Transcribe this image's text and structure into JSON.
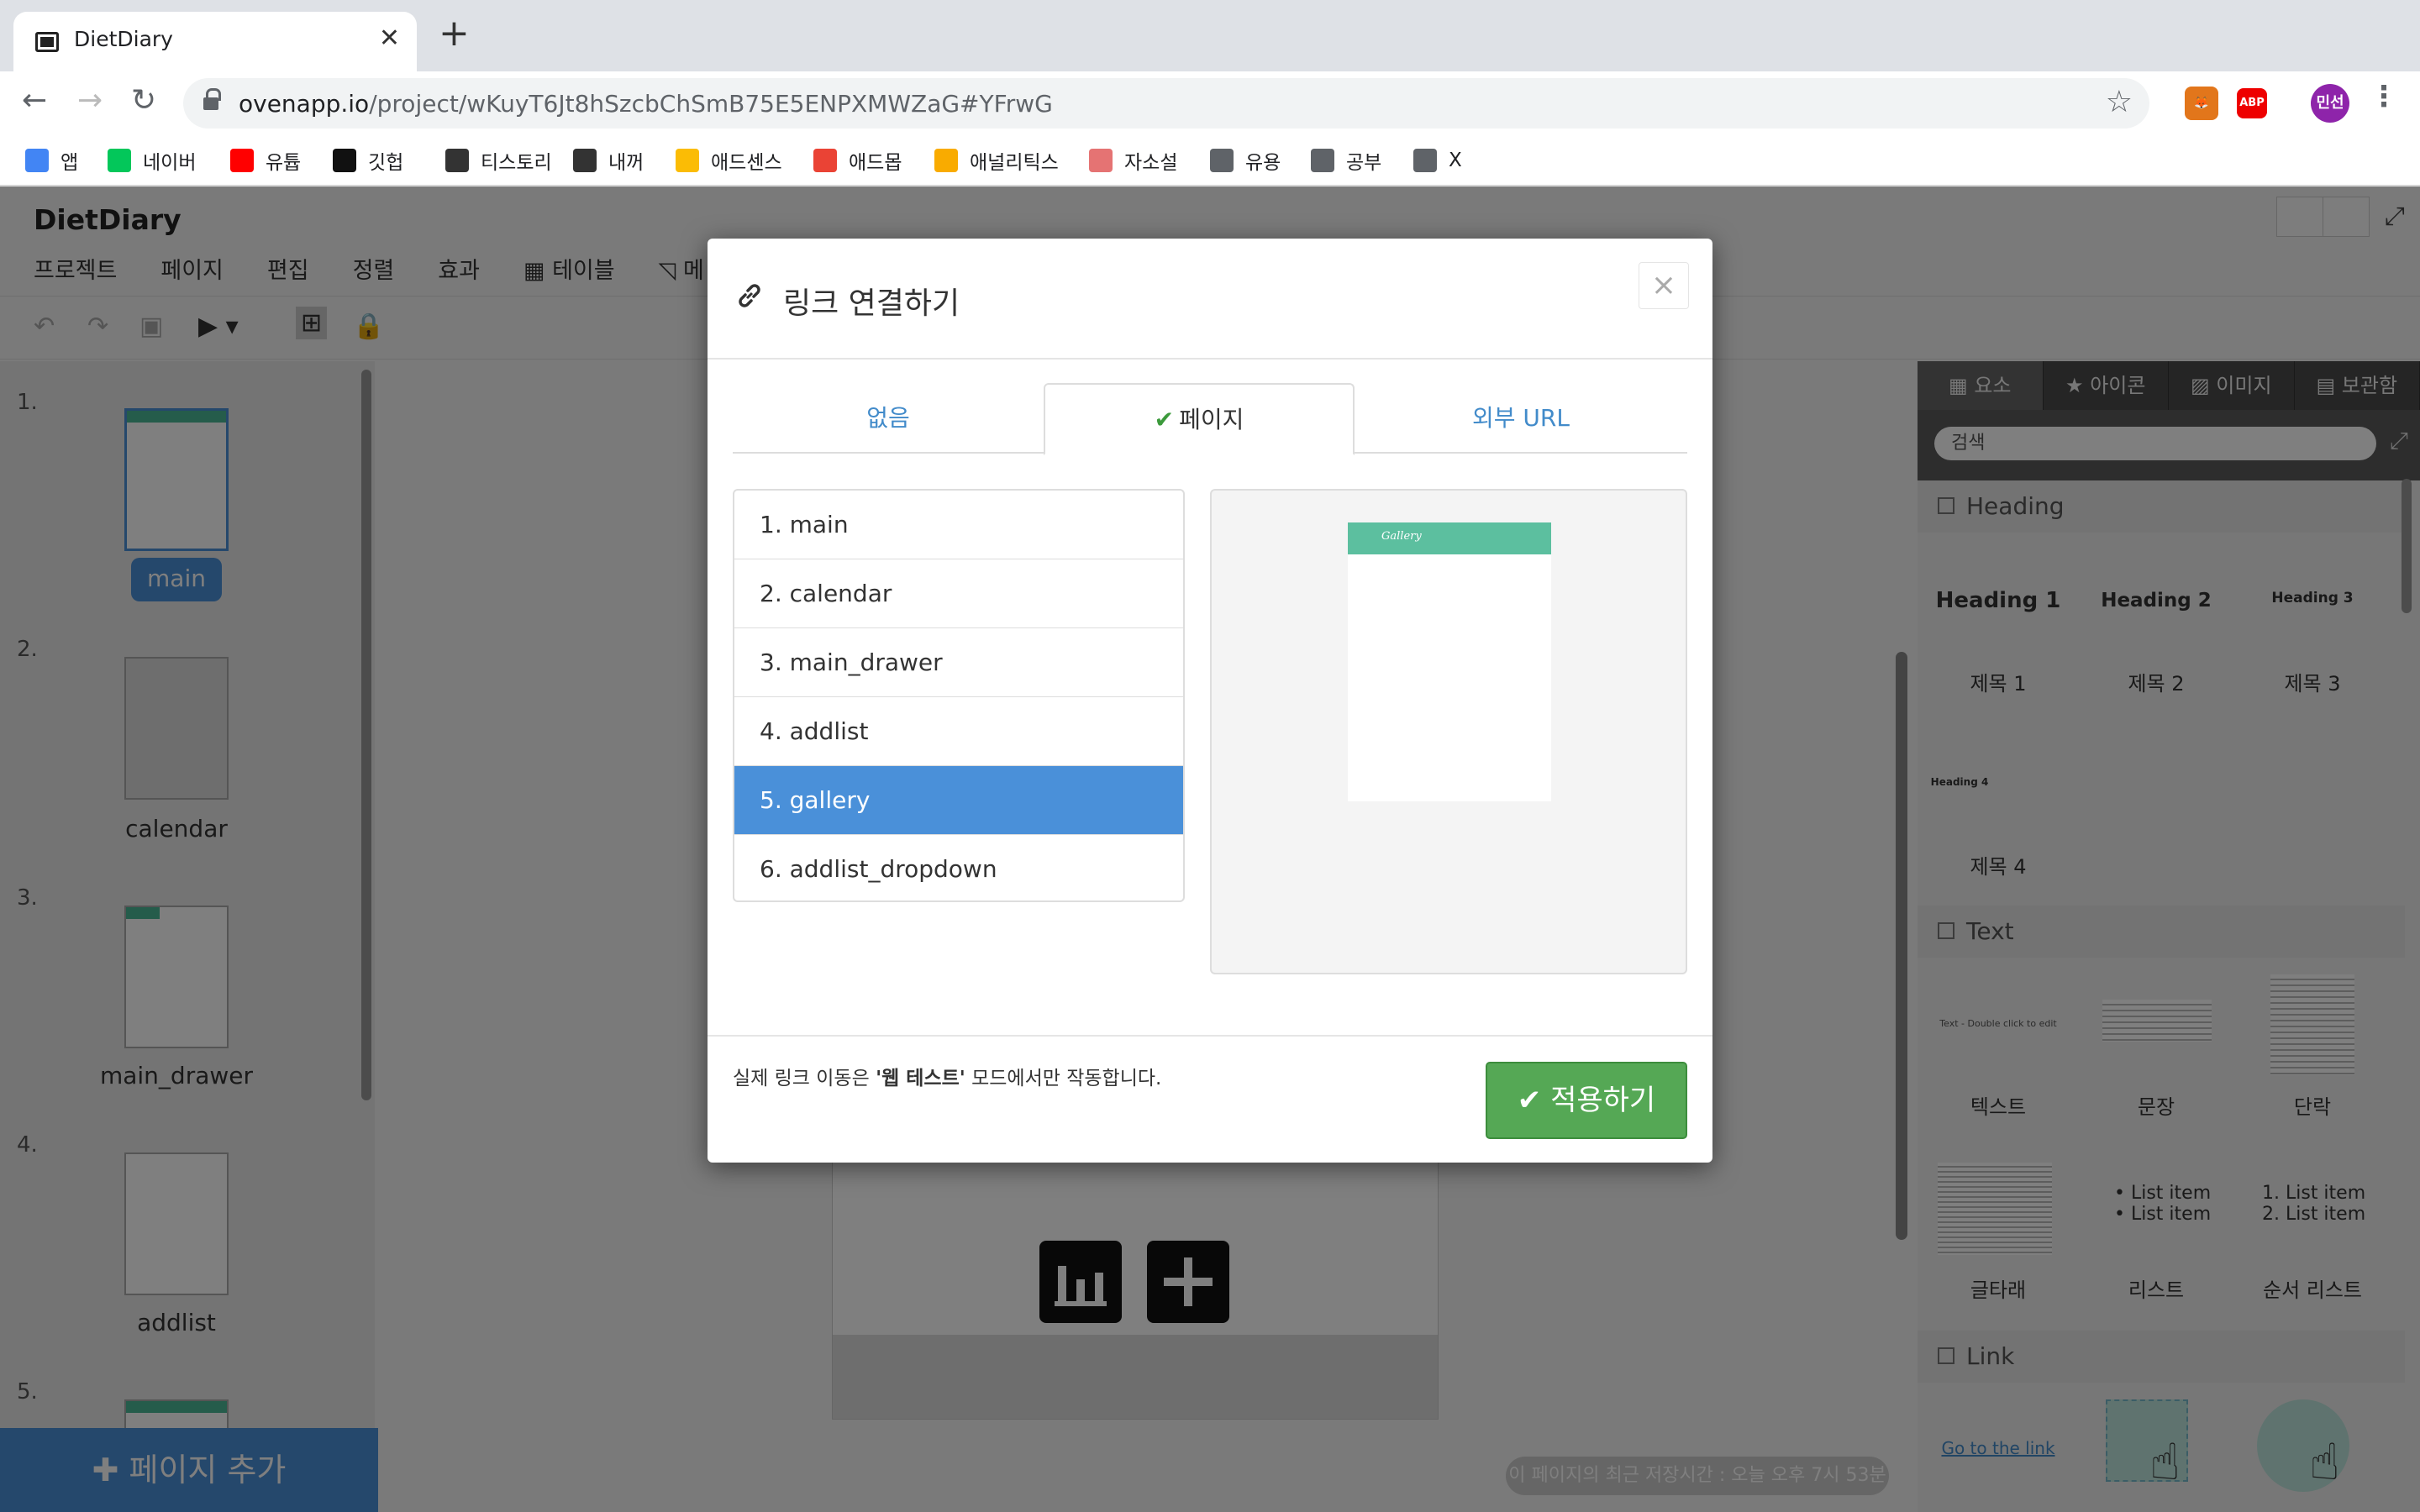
{
  "browser": {
    "tab_title": "DietDiary",
    "tab_close": "✕",
    "new_tab": "+",
    "url_host": "ovenapp.io",
    "url_path": "/project/wKuyT6Jt8hSzcbChSmB75E5ENPXMWZaG#YFrwG",
    "profile_label": "민선",
    "abp_label": "ABP",
    "bookmarks": [
      {
        "label": "앱",
        "color": "#4285f4"
      },
      {
        "label": "네이버",
        "color": "#03c75a"
      },
      {
        "label": "유튭",
        "color": "#ff0000"
      },
      {
        "label": "깃헙",
        "color": "#111111"
      },
      {
        "label": "티스토리",
        "color": "#333333"
      },
      {
        "label": "내꺼",
        "color": "#333333"
      },
      {
        "label": "애드센스",
        "color": "#fbbc05"
      },
      {
        "label": "애드몹",
        "color": "#ea4335"
      },
      {
        "label": "애널리틱스",
        "color": "#f9ab00"
      },
      {
        "label": "자소설",
        "color": "#e57373"
      },
      {
        "label": "유용",
        "color": "#5f6368"
      },
      {
        "label": "공부",
        "color": "#5f6368"
      },
      {
        "label": "X",
        "color": "#5f6368"
      }
    ]
  },
  "app": {
    "title": "DietDiary",
    "menu": [
      "프로젝트",
      "페이지",
      "편집",
      "정렬",
      "효과",
      "테이블",
      "메"
    ],
    "pages": [
      {
        "num": "1.",
        "label": "main"
      },
      {
        "num": "2.",
        "label": "calendar"
      },
      {
        "num": "3.",
        "label": "main_drawer"
      },
      {
        "num": "4.",
        "label": "addlist"
      },
      {
        "num": "5.",
        "label": ""
      }
    ],
    "add_page": "페이지 추가",
    "save_status": "이 페이지의 최근 저장시간 : 오늘 오후 7시 53분"
  },
  "right_panel": {
    "tabs": [
      "요소",
      "아이콘",
      "이미지",
      "보관함"
    ],
    "search_placeholder": "검색",
    "sections": {
      "heading": "Heading",
      "text": "Text",
      "link": "Link"
    },
    "heading_items": [
      {
        "preview": "Heading 1",
        "label": "제목 1"
      },
      {
        "preview": "Heading 2",
        "label": "제목 2"
      },
      {
        "preview": "Heading 3",
        "label": "제목 3"
      },
      {
        "preview": "Heading 4",
        "label": "제목 4"
      }
    ],
    "text_items": [
      {
        "preview": "Text - Double click to edit",
        "label": "텍스트"
      },
      {
        "preview": "",
        "label": "문장"
      },
      {
        "preview": "",
        "label": "단락"
      },
      {
        "preview": "",
        "label": "글타래"
      },
      {
        "preview": "• List item",
        "label": "리스트"
      },
      {
        "preview": "1. List item",
        "label": "순서 리스트"
      }
    ],
    "list_preview": [
      "• List item",
      "• List item"
    ],
    "olist_preview": [
      "1. List item",
      "2. List item"
    ],
    "link_items": [
      {
        "preview": "Go to the link"
      }
    ]
  },
  "modal": {
    "title": "링크 연결하기",
    "close": "×",
    "tabs": {
      "none": "없음",
      "page": "페이지",
      "external": "외부 URL"
    },
    "page_list": [
      "1. main",
      "2. calendar",
      "3. main_drawer",
      "4. addlist",
      "5. gallery",
      "6. addlist_dropdown"
    ],
    "selected_index": 4,
    "preview_header": "Gallery",
    "footnote_prefix": "실제 링크 이동은 ",
    "footnote_bold": "'웹 테스트'",
    "footnote_suffix": " 모드에서만 작동합니다.",
    "apply": "적용하기"
  },
  "colors": {
    "accent": "#4a90d9",
    "apply_green": "#55a855",
    "header_teal": "#5cbf9f"
  }
}
